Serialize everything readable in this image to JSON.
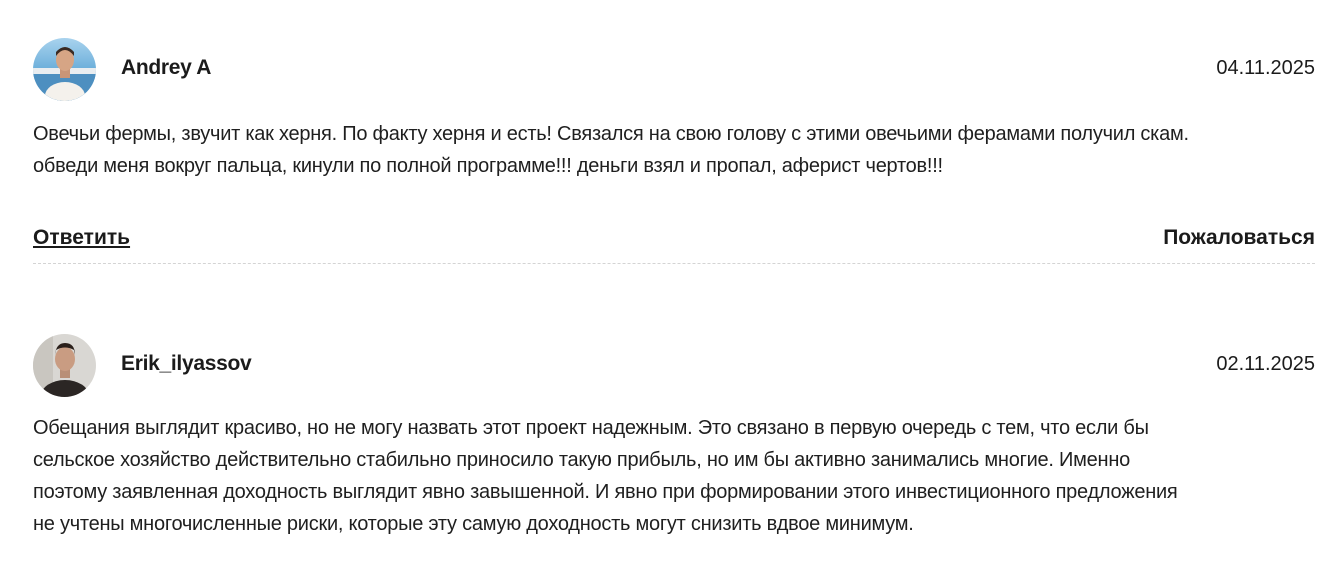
{
  "comments": [
    {
      "author": "Andrey A",
      "date": "04.11.2025",
      "text_lines": [
        "Овечьи фермы, звучит как херня. По факту херня и есть! Связался на свою голову с этими овечьими ферамами получил скам.",
        "обведи меня вокруг пальца, кинули по полной программе!!! деньги взял и пропал, аферист чертов!!!"
      ],
      "reply_label": "Ответить",
      "report_label": "Пожаловаться",
      "avatar_icon": "user-photo-icon"
    },
    {
      "author": "Erik_ilyassov",
      "date": "02.11.2025",
      "text_lines": [
        "Обещания выглядит красиво, но не могу назвать этот проект надежным. Это связано в первую очередь с тем, что если бы",
        "сельское хозяйство действительно стабильно приносило такую прибыль, но им бы активно занимались многие. Именно",
        "поэтому заявленная доходность выглядит явно завышенной. И явно при формировании этого инвестиционного предложения",
        "не учтены многочисленные риски, которые эту самую доходность могут снизить вдвое минимум."
      ],
      "avatar_icon": "user-photo-icon"
    }
  ],
  "colors": {
    "text": "#1f1f1f",
    "divider": "#d4d4d4",
    "background": "#ffffff"
  }
}
